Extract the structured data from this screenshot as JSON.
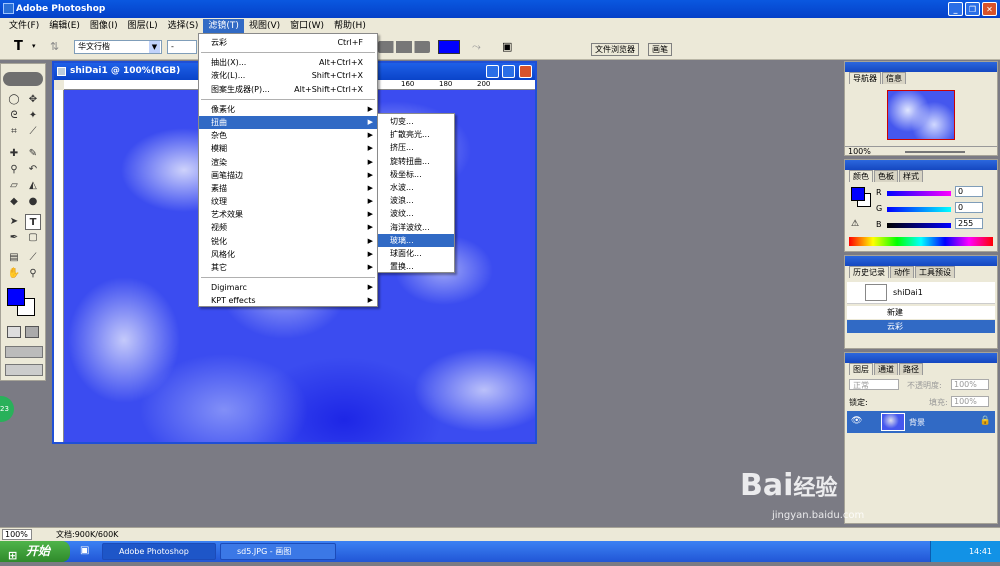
{
  "app": {
    "title": "Adobe Photoshop"
  },
  "menubar": [
    "文件(F)",
    "编辑(E)",
    "图像(I)",
    "图层(L)",
    "选择(S)",
    "滤镜(T)",
    "视图(V)",
    "窗口(W)",
    "帮助(H)"
  ],
  "options": {
    "font_family": "华文行楷",
    "font_style": "-",
    "tab_file_browser": "文件浏览器",
    "tab_brushes": "画笔"
  },
  "document": {
    "title": "shiDai1 @ 100%(RGB)",
    "ruler_marks": [
      "160",
      "180",
      "200"
    ]
  },
  "filter_menu": {
    "top": [
      {
        "label": "云彩",
        "shortcut": "Ctrl+F"
      }
    ],
    "group1": [
      {
        "label": "抽出(X)...",
        "shortcut": "Alt+Ctrl+X"
      },
      {
        "label": "液化(L)...",
        "shortcut": "Shift+Ctrl+X"
      },
      {
        "label": "图案生成器(P)...",
        "shortcut": "Alt+Shift+Ctrl+X"
      }
    ],
    "group2": [
      "像素化",
      "扭曲",
      "杂色",
      "模糊",
      "渲染",
      "画笔描边",
      "素描",
      "纹理",
      "艺术效果",
      "视频",
      "锐化",
      "风格化",
      "其它"
    ],
    "group3": [
      "Digimarc",
      "KPT effects"
    ]
  },
  "distort_submenu": [
    "切变...",
    "扩散亮光...",
    "挤压...",
    "旋转扭曲...",
    "极坐标...",
    "水波...",
    "波浪...",
    "波纹...",
    "海洋波纹...",
    "玻璃...",
    "球面化...",
    "置换..."
  ],
  "navigator": {
    "tabs": [
      "导航器",
      "信息"
    ],
    "zoom": "100%"
  },
  "color": {
    "tabs": [
      "颜色",
      "色板",
      "样式"
    ],
    "r_label": "R",
    "g_label": "G",
    "b_label": "B",
    "r": "0",
    "g": "0",
    "b": "255"
  },
  "history": {
    "tabs": [
      "历史记录",
      "动作",
      "工具预设"
    ],
    "snapshot": "shiDai1",
    "items": [
      "新建",
      "云彩"
    ]
  },
  "layers": {
    "tabs": [
      "图层",
      "通道",
      "路径"
    ],
    "blend": "正常",
    "opacity_label": "不透明度:",
    "opacity": "100%",
    "lock_label": "锁定:",
    "fill_label": "填充:",
    "fill": "100%",
    "layer_name": "背景"
  },
  "status": {
    "zoom": "100%",
    "doc": "文档:900K/600K"
  },
  "taskbar": {
    "start": "开始",
    "tasks": [
      "Adobe Photoshop",
      "sd5.JPG - 画图"
    ],
    "clock": "14:41"
  },
  "watermark": {
    "brand": "Bai",
    "brand2": "经验",
    "url": "jingyan.baidu.com"
  },
  "colors": {
    "fg": "#0000ff",
    "accent": "#316ac5",
    "canvas": "#3b4cf0"
  }
}
